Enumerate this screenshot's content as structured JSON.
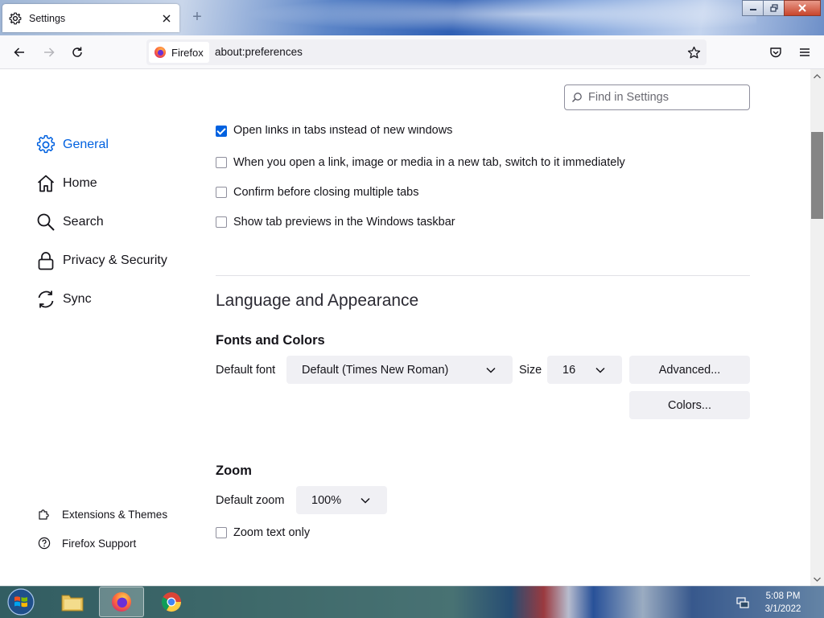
{
  "tab": {
    "title": "Settings"
  },
  "navbar": {
    "identity_label": "Firefox",
    "url": "about:preferences"
  },
  "search": {
    "placeholder": "Find in Settings"
  },
  "sidebar": {
    "items": [
      {
        "label": "General",
        "icon": "gear-icon",
        "selected": true
      },
      {
        "label": "Home",
        "icon": "home-icon"
      },
      {
        "label": "Search",
        "icon": "search-icon"
      },
      {
        "label": "Privacy & Security",
        "icon": "lock-icon"
      },
      {
        "label": "Sync",
        "icon": "sync-icon"
      }
    ],
    "footer": [
      {
        "label": "Extensions & Themes",
        "icon": "puzzle-icon"
      },
      {
        "label": "Firefox Support",
        "icon": "help-icon"
      }
    ]
  },
  "tabs_section": {
    "options": [
      {
        "label": "Open links in tabs instead of new windows",
        "checked": true
      },
      {
        "label": "When you open a link, image or media in a new tab, switch to it immediately",
        "checked": false
      },
      {
        "label": "Confirm before closing multiple tabs",
        "checked": false
      },
      {
        "label": "Show tab previews in the Windows taskbar",
        "checked": false
      }
    ]
  },
  "language": {
    "heading": "Language and Appearance",
    "fonts_heading": "Fonts and Colors",
    "default_font_label": "Default font",
    "default_font_value": "Default (Times New Roman)",
    "size_label": "Size",
    "size_value": "16",
    "advanced_button": "Advanced...",
    "colors_button": "Colors..."
  },
  "zoom": {
    "heading": "Zoom",
    "default_zoom_label": "Default zoom",
    "default_zoom_value": "100%",
    "text_only_label": "Zoom text only",
    "text_only_checked": false
  },
  "taskbar": {
    "time": "5:08 PM",
    "date": "3/1/2022"
  },
  "colors": {
    "accent": "#0061e0"
  }
}
